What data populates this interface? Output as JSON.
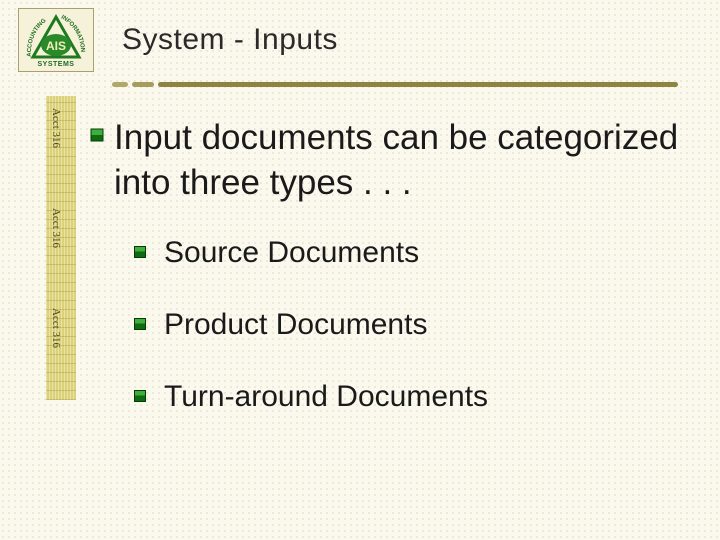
{
  "logo": {
    "top_text": "INFORMATION",
    "center": "AIS",
    "left_text": "ACCOUNTING",
    "bottom_text": "SYSTEMS"
  },
  "title": "System  -  Inputs",
  "sidebar": {
    "labels": [
      "Acct 316",
      "Acct 316",
      "Acct 316"
    ]
  },
  "lead": "Input documents can be categorized into three types . . .",
  "items": [
    "Source Documents",
    "Product Documents",
    "Turn-around Documents"
  ],
  "colors": {
    "accent": "#1f7a1f",
    "bullet_fill": "#0f6b0f",
    "bullet_glow": "#3fae3f"
  }
}
